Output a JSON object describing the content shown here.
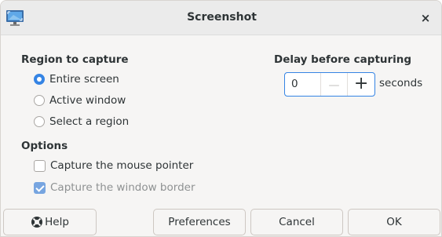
{
  "window": {
    "title": "Screenshot",
    "close_glyph": "×",
    "app_icon": "screenshot-monitor-icon"
  },
  "region": {
    "heading": "Region to capture",
    "options": [
      {
        "label": "Entire screen",
        "selected": true
      },
      {
        "label": "Active window",
        "selected": false
      },
      {
        "label": "Select a region",
        "selected": false
      }
    ]
  },
  "options": {
    "heading": "Options",
    "checkboxes": [
      {
        "label": "Capture the mouse pointer",
        "checked": false,
        "enabled": true
      },
      {
        "label": "Capture the window border",
        "checked": true,
        "enabled": false
      }
    ]
  },
  "delay": {
    "heading": "Delay before capturing",
    "value": "0",
    "minus_glyph": "—",
    "plus_glyph": "+",
    "unit": "seconds"
  },
  "buttons": {
    "help": "Help",
    "preferences": "Preferences",
    "cancel": "Cancel",
    "ok": "OK"
  },
  "colors": {
    "accent": "#3584e4",
    "window_bg": "#f6f5f4",
    "text": "#2e3436"
  }
}
